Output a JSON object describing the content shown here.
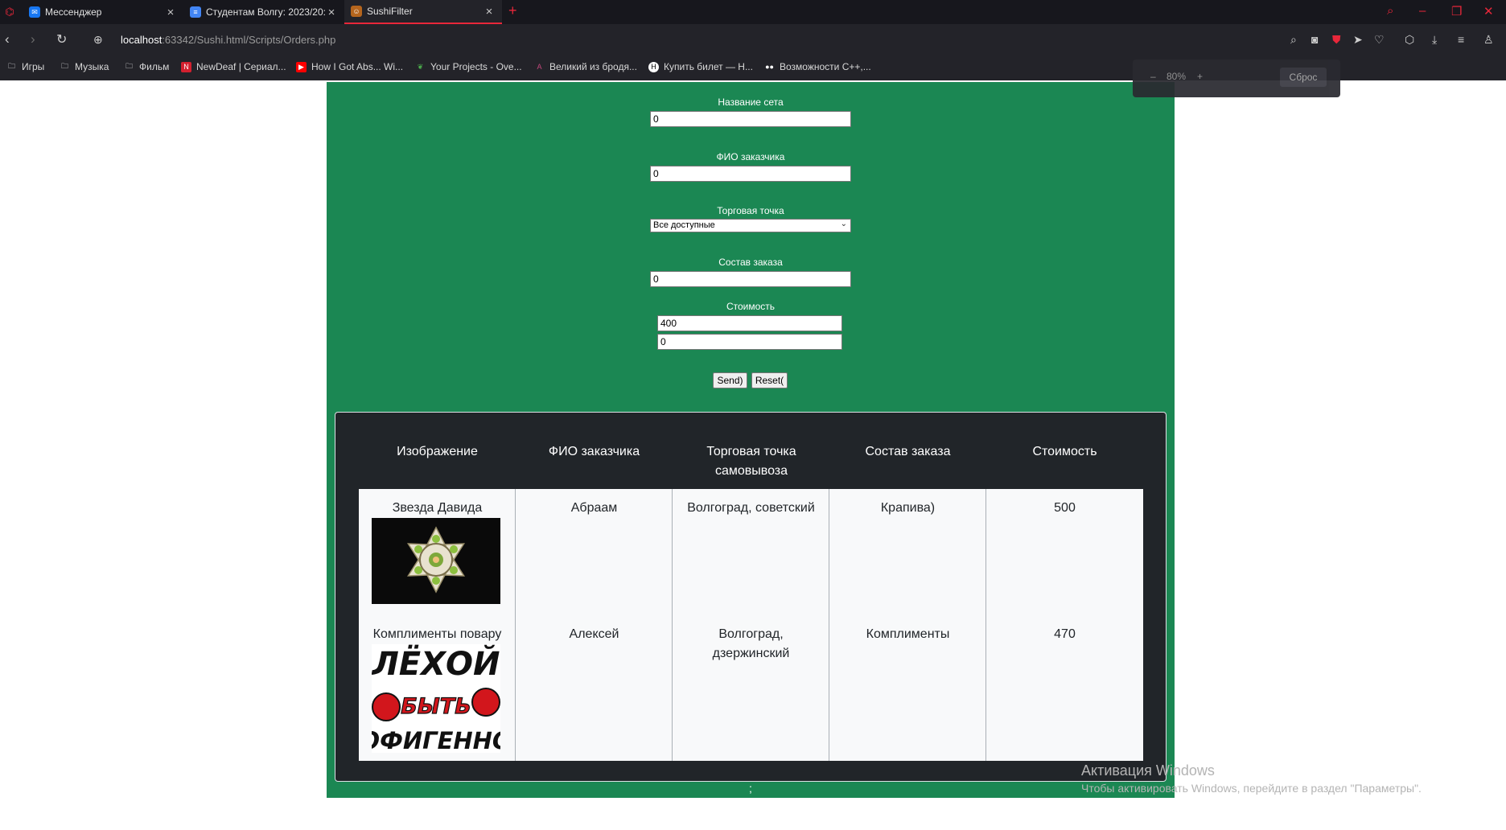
{
  "browser": {
    "tabs": [
      {
        "title": "Мессенджер",
        "icon": "messenger-icon",
        "color": "#1877f2"
      },
      {
        "title": "Студентам Волгу: 2023/20:",
        "icon": "docs-icon",
        "color": "#4285f4"
      },
      {
        "title": "SushiFilter",
        "icon": "site-favicon",
        "color": "#b5651d"
      }
    ],
    "url_host": "localhost",
    "url_rest": ":63342/Sushi.html/Scripts/Orders.php",
    "bookmarks": [
      {
        "label": "Игры",
        "icon": "folder-icon"
      },
      {
        "label": "Музыка",
        "icon": "folder-icon"
      },
      {
        "label": "Фильм",
        "icon": "folder-icon"
      },
      {
        "label": "NewDeaf | Сериал...",
        "icon": "newdeaf-icon"
      },
      {
        "label": "How I Got Abs... Wi...",
        "icon": "youtube-icon"
      },
      {
        "label": "Your Projects - Ove...",
        "icon": "overleaf-icon"
      },
      {
        "label": "Великий из бродя...",
        "icon": "anime-icon"
      },
      {
        "label": "Купить билет — Н...",
        "icon": "h-icon"
      },
      {
        "label": "Возможности C++,...",
        "icon": "medium-icon"
      }
    ],
    "zoom": {
      "minus": "–",
      "value": "80%",
      "plus": "+",
      "reset": "Сброс"
    },
    "accent": "#e8273a"
  },
  "form": {
    "set_name": {
      "label": "Название сета",
      "value": "0"
    },
    "customer": {
      "label": "ФИО заказчика",
      "value": "0"
    },
    "outlet": {
      "label": "Торговая точка",
      "selected": "Все доступные"
    },
    "composition": {
      "label": "Состав заказа",
      "value": "0"
    },
    "price": {
      "label": "Стоимость",
      "min": "400",
      "max": "0"
    },
    "send": "Send)",
    "reset": "Reset("
  },
  "table": {
    "headers": [
      "Изображение",
      "ФИО заказчика",
      "Торговая точка самовывоза",
      "Состав заказа",
      "Стоимость"
    ],
    "rows": [
      {
        "image_caption": "Звезда Давида",
        "customer": "Абраам",
        "outlet": "Волгоград, советский",
        "composition": "Крапива)",
        "price": "500"
      },
      {
        "image_caption": "Комплименты повару",
        "customer": "Алексей",
        "outlet": "Волгоград, дзержинский",
        "composition": "Комплименты",
        "price": "470"
      }
    ],
    "meme_text": [
      "ЛЁХОЙ",
      "БЫТЬ",
      "ОФИГЕННО"
    ]
  },
  "footer_dot": ";",
  "watermark": {
    "title": "Активация Windows",
    "subtitle": "Чтобы активировать Windows, перейдите в раздел \"Параметры\"."
  },
  "colors": {
    "panel": "#1b8753",
    "table_dark": "#212529",
    "table_light": "#f8f9fa"
  }
}
